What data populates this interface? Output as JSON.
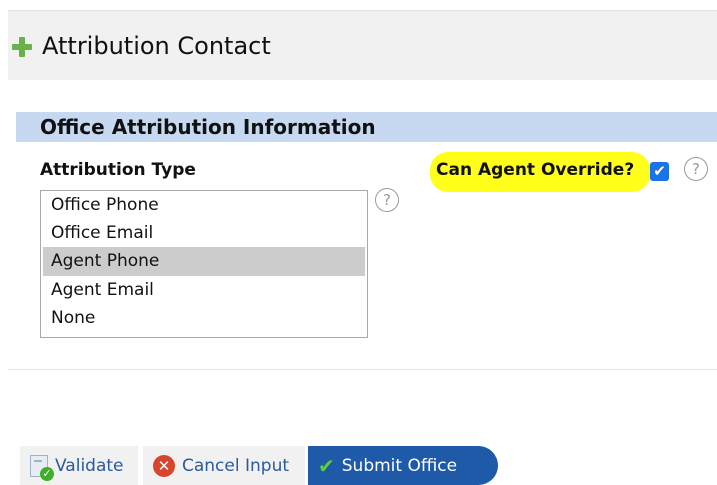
{
  "header": {
    "title": "Attribution Contact"
  },
  "section": {
    "title": "Office Attribution Information"
  },
  "attribution_type": {
    "label": "Attribution Type",
    "options": [
      "Office Phone",
      "Office Email",
      "Agent Phone",
      "Agent Email",
      "None"
    ],
    "selected": "Agent Phone"
  },
  "agent_override": {
    "label": "Can Agent Override?",
    "checked": true
  },
  "help": {
    "glyph": "?"
  },
  "buttons": {
    "validate_label": "Validate",
    "cancel_label": "Cancel Input",
    "submit_label": "Submit Office"
  },
  "colors": {
    "section_bar": "#c6d9f1",
    "header_bg": "#f1f1f1",
    "submit_bg": "#1f5aa8",
    "highlight": "#ffff1a",
    "checkbox": "#1a73e8"
  },
  "icons": [
    "plus-icon",
    "help-icon",
    "checkbox-check-icon",
    "validate-icon",
    "cancel-icon",
    "check-icon"
  ]
}
